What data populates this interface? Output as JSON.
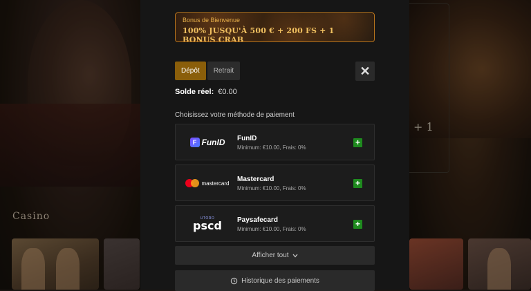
{
  "background": {
    "plus_text": "+ 1",
    "casino_label": "Casino"
  },
  "bonus": {
    "title": "Bonus de Bienvenue",
    "text": "100% JUSQU'À 500 € + 200 FS + 1 BONUS CRAB"
  },
  "tabs": [
    {
      "label": "Dépôt",
      "active": true
    },
    {
      "label": "Retrait",
      "active": false
    }
  ],
  "close_icon": "close-icon",
  "balance": {
    "label": "Solde réel:",
    "value": "€0.00"
  },
  "payment_section": {
    "heading": "Choisissez votre méthode de paiement",
    "methods": [
      {
        "name": "FunID",
        "info": "Minimum: €10.00, Frais: 0%",
        "logo_text": "FunID",
        "logo_icon": "F"
      },
      {
        "name": "Mastercard",
        "info": "Minimum: €10.00, Frais: 0%",
        "logo_text": "mastercard"
      },
      {
        "name": "Paysafecard",
        "info": "Minimum: €10.00, Frais: 0%",
        "logo_text": "pscd",
        "logo_sub": "UTORO"
      }
    ],
    "add_icon_text": "+"
  },
  "show_all": {
    "label": "Afficher tout",
    "icon": "chevron-down-icon"
  },
  "history": {
    "label": "Historique des paiements",
    "icon": "history-icon"
  },
  "colors": {
    "accent_gold": "#8a5e0a",
    "bonus_border": "#b8741c",
    "add_green": "#1e8a1e"
  }
}
